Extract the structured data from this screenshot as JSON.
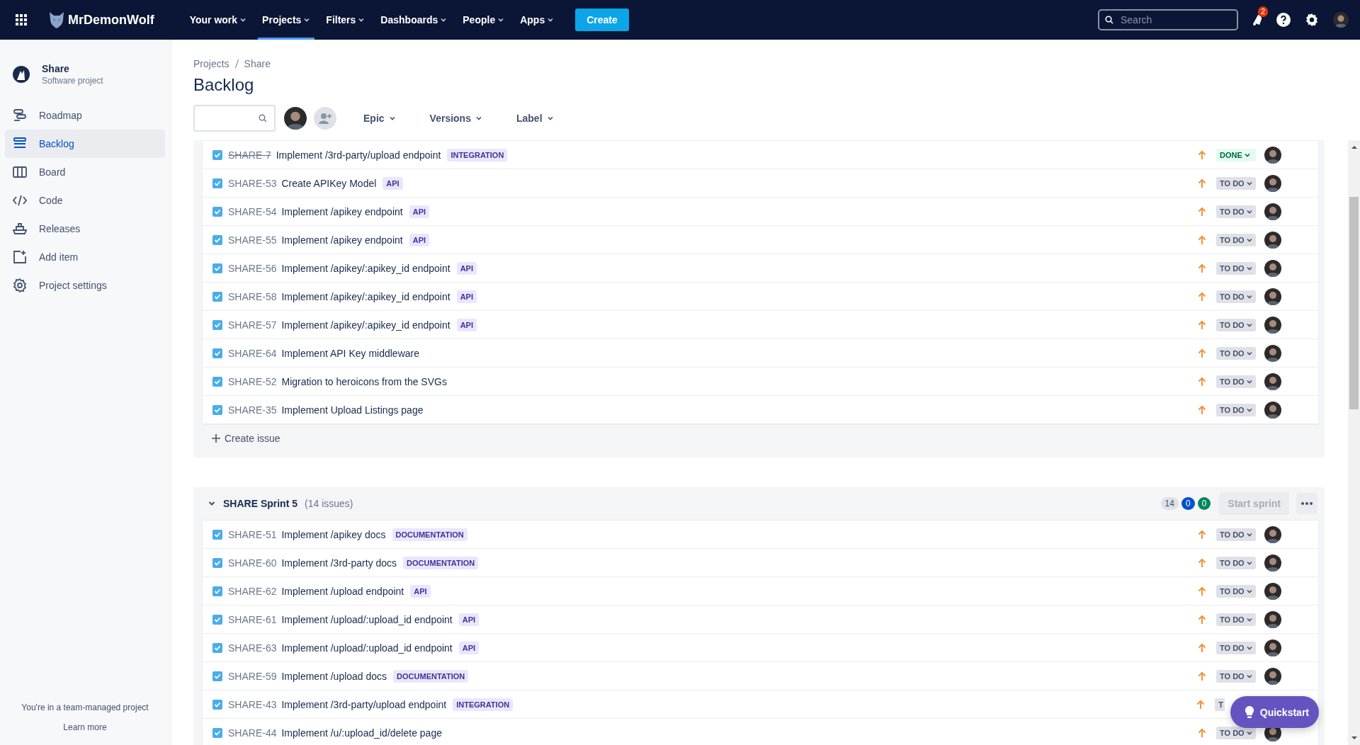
{
  "topbar": {
    "logo_text": "MrDemonWolf",
    "nav": [
      {
        "label": "Your work",
        "selected": false
      },
      {
        "label": "Projects",
        "selected": true
      },
      {
        "label": "Filters",
        "selected": false
      },
      {
        "label": "Dashboards",
        "selected": false
      },
      {
        "label": "People",
        "selected": false
      },
      {
        "label": "Apps",
        "selected": false
      }
    ],
    "create_label": "Create",
    "search": {
      "placeholder": "Search"
    },
    "notification_count": "2"
  },
  "sidebar": {
    "project": {
      "name": "Share",
      "type": "Software project"
    },
    "items": [
      {
        "label": "Roadmap",
        "selected": false
      },
      {
        "label": "Backlog",
        "selected": true
      },
      {
        "label": "Board",
        "selected": false
      },
      {
        "label": "Code",
        "selected": false
      },
      {
        "label": "Releases",
        "selected": false
      },
      {
        "label": "Add item",
        "selected": false
      },
      {
        "label": "Project settings",
        "selected": false
      }
    ],
    "footer": {
      "text": "You're in a team-managed project",
      "link": "Learn more"
    }
  },
  "breadcrumb": [
    "Projects",
    "Share"
  ],
  "title": "Backlog",
  "filters": [
    "Epic",
    "Versions",
    "Label"
  ],
  "sprints": [
    {
      "issues": [
        {
          "key": "SHARE-7",
          "resolved": true,
          "summary": "Implement /3rd-party/upload endpoint",
          "label": "INTEGRATION",
          "status": {
            "text": "DONE",
            "kind": "done"
          }
        },
        {
          "key": "SHARE-53",
          "resolved": false,
          "summary": "Create APIKey Model",
          "label": "API",
          "status": {
            "text": "TO DO",
            "kind": "todo"
          }
        },
        {
          "key": "SHARE-54",
          "resolved": false,
          "summary": "Implement /apikey endpoint",
          "label": "API",
          "status": {
            "text": "TO DO",
            "kind": "todo"
          }
        },
        {
          "key": "SHARE-55",
          "resolved": false,
          "summary": "Implement /apikey endpoint",
          "label": "API",
          "status": {
            "text": "TO DO",
            "kind": "todo"
          }
        },
        {
          "key": "SHARE-56",
          "resolved": false,
          "summary": "Implement /apikey/:apikey_id endpoint",
          "label": "API",
          "status": {
            "text": "TO DO",
            "kind": "todo"
          }
        },
        {
          "key": "SHARE-58",
          "resolved": false,
          "summary": "Implement /apikey/:apikey_id endpoint",
          "label": "API",
          "status": {
            "text": "TO DO",
            "kind": "todo"
          }
        },
        {
          "key": "SHARE-57",
          "resolved": false,
          "summary": "Implement /apikey/:apikey_id endpoint",
          "label": "API",
          "status": {
            "text": "TO DO",
            "kind": "todo"
          }
        },
        {
          "key": "SHARE-64",
          "resolved": false,
          "summary": "Implement API Key middleware",
          "status": {
            "text": "TO DO",
            "kind": "todo"
          }
        },
        {
          "key": "SHARE-52",
          "resolved": false,
          "summary": "Migration to heroicons from the SVGs",
          "status": {
            "text": "TO DO",
            "kind": "todo"
          }
        },
        {
          "key": "SHARE-35",
          "resolved": false,
          "summary": "Implement Upload Listings page",
          "status": {
            "text": "TO DO",
            "kind": "todo"
          }
        }
      ],
      "create_issue": "Create issue"
    },
    {
      "header": {
        "name": "SHARE Sprint 5",
        "count_text": "(14 issues)",
        "counts": [
          {
            "value": "14",
            "kind": "todo"
          },
          {
            "value": "0",
            "kind": "in_progress"
          },
          {
            "value": "0",
            "kind": "done"
          }
        ],
        "start_button": {
          "label": "Start sprint",
          "disabled": true
        }
      },
      "issues": [
        {
          "key": "SHARE-51",
          "resolved": false,
          "summary": "Implement /apikey docs",
          "label": "DOCUMENTATION",
          "status": {
            "text": "TO DO",
            "kind": "todo"
          }
        },
        {
          "key": "SHARE-60",
          "resolved": false,
          "summary": "Implement /3rd-party docs",
          "label": "DOCUMENTATION",
          "status": {
            "text": "TO DO",
            "kind": "todo"
          }
        },
        {
          "key": "SHARE-62",
          "resolved": false,
          "summary": "Implement /upload endpoint",
          "label": "API",
          "status": {
            "text": "TO DO",
            "kind": "todo"
          }
        },
        {
          "key": "SHARE-61",
          "resolved": false,
          "summary": "Implement /upload/:upload_id endpoint",
          "label": "API",
          "status": {
            "text": "TO DO",
            "kind": "todo"
          }
        },
        {
          "key": "SHARE-63",
          "resolved": false,
          "summary": "Implement /upload/:upload_id endpoint",
          "label": "API",
          "status": {
            "text": "TO DO",
            "kind": "todo"
          }
        },
        {
          "key": "SHARE-59",
          "resolved": false,
          "summary": "Implement /upload docs",
          "label": "DOCUMENTATION",
          "status": {
            "text": "TO DO",
            "kind": "todo"
          }
        },
        {
          "key": "SHARE-43",
          "resolved": false,
          "summary": "Implement /3rd-party/upload endpoint",
          "label": "INTEGRATION",
          "status": {
            "text": "T",
            "kind": "todo",
            "cut": true
          }
        },
        {
          "key": "SHARE-44",
          "resolved": false,
          "summary": "Implement /u/:upload_id/delete page",
          "status": {
            "text": "TO DO",
            "kind": "todo"
          }
        }
      ]
    }
  ],
  "quickstart": "Quickstart"
}
